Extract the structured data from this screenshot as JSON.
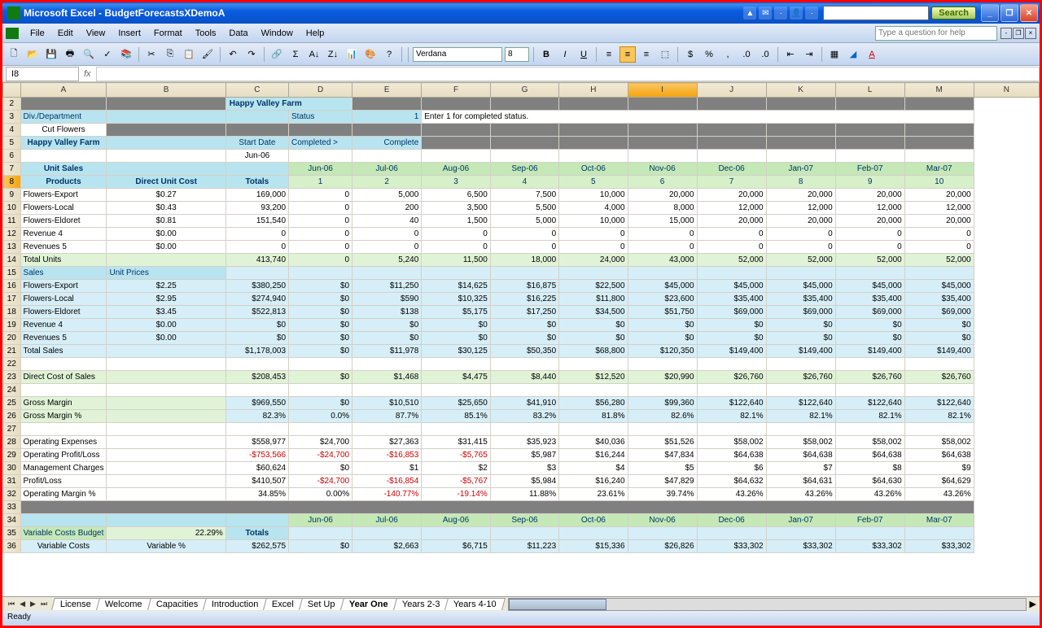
{
  "title": "Microsoft Excel - BudgetForecastsXDemoA",
  "menu": [
    "File",
    "Edit",
    "View",
    "Insert",
    "Format",
    "Tools",
    "Data",
    "Window",
    "Help"
  ],
  "help_ph": "Type a question for help",
  "search_btn": "Search",
  "font": "Verdana",
  "fontsize": "8",
  "namebox": "I8",
  "status": "Ready",
  "tabs": [
    "License",
    "Welcome",
    "Capacities",
    "Introduction",
    "Excel",
    "Set Up",
    "Year One",
    "Years 2-3",
    "Years 4-10"
  ],
  "active_tab": 6,
  "cols": [
    "A",
    "B",
    "C",
    "D",
    "E",
    "F",
    "G",
    "H",
    "I",
    "J",
    "K",
    "L",
    "M",
    "N"
  ],
  "sel_col": 8,
  "title2": "Happy Valley Farm",
  "r3": {
    "b": "Div./Department",
    "e": "Status",
    "f": "1",
    "g": "Enter 1 for completed status."
  },
  "r4": {
    "b": "Cut Flowers"
  },
  "r5": {
    "b": "Happy Valley Farm",
    "d": "Start Date",
    "e": "Completed >",
    "f": "Complete"
  },
  "r6": {
    "d": "Jun-06"
  },
  "r7": {
    "b": "Unit Sales",
    "months": [
      "Jun-06",
      "Jul-06",
      "Aug-06",
      "Sep-06",
      "Oct-06",
      "Nov-06",
      "Dec-06",
      "Jan-07",
      "Feb-07",
      "Mar-07"
    ]
  },
  "r8": {
    "b": "Products",
    "c": "Direct Unit Cost",
    "d": "Totals",
    "nums": [
      "1",
      "2",
      "3",
      "4",
      "5",
      "6",
      "7",
      "8",
      "9",
      "10"
    ]
  },
  "rows": [
    {
      "n": 9,
      "b": "Flowers-Export",
      "c": "$0.27",
      "d": "169,000",
      "v": [
        "0",
        "5,000",
        "6,500",
        "7,500",
        "10,000",
        "20,000",
        "20,000",
        "20,000",
        "20,000",
        "20,000"
      ]
    },
    {
      "n": 10,
      "b": "Flowers-Local",
      "c": "$0.43",
      "d": "93,200",
      "v": [
        "0",
        "200",
        "3,500",
        "5,500",
        "4,000",
        "8,000",
        "12,000",
        "12,000",
        "12,000",
        "12,000"
      ]
    },
    {
      "n": 11,
      "b": "Flowers-Eldoret",
      "c": "$0.81",
      "d": "151,540",
      "v": [
        "0",
        "40",
        "1,500",
        "5,000",
        "10,000",
        "15,000",
        "20,000",
        "20,000",
        "20,000",
        "20,000"
      ]
    },
    {
      "n": 12,
      "b": "Revenue 4",
      "c": "$0.00",
      "d": "0",
      "v": [
        "0",
        "0",
        "0",
        "0",
        "0",
        "0",
        "0",
        "0",
        "0",
        "0"
      ]
    },
    {
      "n": 13,
      "b": "Revenues 5",
      "c": "$0.00",
      "d": "0",
      "v": [
        "0",
        "0",
        "0",
        "0",
        "0",
        "0",
        "0",
        "0",
        "0",
        "0"
      ]
    }
  ],
  "r14": {
    "b": "Total Units",
    "d": "413,740",
    "v": [
      "0",
      "5,240",
      "11,500",
      "18,000",
      "24,000",
      "43,000",
      "52,000",
      "52,000",
      "52,000",
      "52,000"
    ]
  },
  "r15": {
    "b": "Sales",
    "c": "Unit Prices"
  },
  "srows": [
    {
      "n": 16,
      "b": "Flowers-Export",
      "c": "$2.25",
      "d": "$380,250",
      "v": [
        "$0",
        "$11,250",
        "$14,625",
        "$16,875",
        "$22,500",
        "$45,000",
        "$45,000",
        "$45,000",
        "$45,000",
        "$45,000"
      ]
    },
    {
      "n": 17,
      "b": "Flowers-Local",
      "c": "$2.95",
      "d": "$274,940",
      "v": [
        "$0",
        "$590",
        "$10,325",
        "$16,225",
        "$11,800",
        "$23,600",
        "$35,400",
        "$35,400",
        "$35,400",
        "$35,400"
      ]
    },
    {
      "n": 18,
      "b": "Flowers-Eldoret",
      "c": "$3.45",
      "d": "$522,813",
      "v": [
        "$0",
        "$138",
        "$5,175",
        "$17,250",
        "$34,500",
        "$51,750",
        "$69,000",
        "$69,000",
        "$69,000",
        "$69,000"
      ]
    },
    {
      "n": 19,
      "b": "Revenue 4",
      "c": "$0.00",
      "d": "$0",
      "v": [
        "$0",
        "$0",
        "$0",
        "$0",
        "$0",
        "$0",
        "$0",
        "$0",
        "$0",
        "$0"
      ]
    },
    {
      "n": 20,
      "b": "Revenues 5",
      "c": "$0.00",
      "d": "$0",
      "v": [
        "$0",
        "$0",
        "$0",
        "$0",
        "$0",
        "$0",
        "$0",
        "$0",
        "$0",
        "$0"
      ]
    }
  ],
  "r21": {
    "b": "Total Sales",
    "d": "$1,178,003",
    "v": [
      "$0",
      "$11,978",
      "$30,125",
      "$50,350",
      "$68,800",
      "$120,350",
      "$149,400",
      "$149,400",
      "$149,400",
      "$149,400"
    ]
  },
  "r23": {
    "b": "Direct Cost of Sales",
    "d": "$208,453",
    "v": [
      "$0",
      "$1,468",
      "$4,475",
      "$8,440",
      "$12,520",
      "$20,990",
      "$26,760",
      "$26,760",
      "$26,760",
      "$26,760"
    ]
  },
  "r25": {
    "b": "Gross Margin",
    "d": "$969,550",
    "v": [
      "$0",
      "$10,510",
      "$25,650",
      "$41,910",
      "$56,280",
      "$99,360",
      "$122,640",
      "$122,640",
      "$122,640",
      "$122,640"
    ]
  },
  "r26": {
    "b": "Gross Margin %",
    "d": "82.3%",
    "v": [
      "0.0%",
      "87.7%",
      "85.1%",
      "83.2%",
      "81.8%",
      "82.6%",
      "82.1%",
      "82.1%",
      "82.1%",
      "82.1%"
    ]
  },
  "r28": {
    "b": "Operating Expenses",
    "d": "$558,977",
    "v": [
      "$24,700",
      "$27,363",
      "$31,415",
      "$35,923",
      "$40,036",
      "$51,526",
      "$58,002",
      "$58,002",
      "$58,002",
      "$58,002"
    ]
  },
  "r29": {
    "b": "Operating Profit/Loss",
    "d": "-$753,566",
    "v": [
      "-$24,700",
      "-$16,853",
      "-$5,765",
      "$5,987",
      "$16,244",
      "$47,834",
      "$64,638",
      "$64,638",
      "$64,638",
      "$64,638"
    ],
    "neg": [
      0,
      1,
      2,
      3
    ]
  },
  "r30": {
    "b": "Management Charges",
    "d": "$60,624",
    "v": [
      "$0",
      "$1",
      "$2",
      "$3",
      "$4",
      "$5",
      "$6",
      "$7",
      "$8",
      "$9"
    ]
  },
  "r31": {
    "b": "Profit/Loss",
    "d": "$410,507",
    "v": [
      "-$24,700",
      "-$16,854",
      "-$5,767",
      "$5,984",
      "$16,240",
      "$47,829",
      "$64,632",
      "$64,631",
      "$64,630",
      "$64,629"
    ],
    "neg": [
      1,
      2,
      3
    ]
  },
  "r32": {
    "b": "Operating Margin %",
    "d": "34.85%",
    "v": [
      "0.00%",
      "-140.77%",
      "-19.14%",
      "11.88%",
      "23.61%",
      "39.74%",
      "43.26%",
      "43.26%",
      "43.26%",
      "43.26%"
    ],
    "neg": [
      2,
      3
    ]
  },
  "r34": {
    "months": [
      "Jun-06",
      "Jul-06",
      "Aug-06",
      "Sep-06",
      "Oct-06",
      "Nov-06",
      "Dec-06",
      "Jan-07",
      "Feb-07",
      "Mar-07"
    ]
  },
  "r35": {
    "b": "Variable Costs Budget",
    "c": "22.29%",
    "d": "Totals"
  },
  "r36": {
    "b": "Variable Costs",
    "c": "Variable %",
    "d": "$262,575",
    "v": [
      "$0",
      "$2,663",
      "$6,715",
      "$11,223",
      "$15,336",
      "$26,826",
      "$33,302",
      "$33,302",
      "$33,302",
      "$33,302"
    ]
  }
}
